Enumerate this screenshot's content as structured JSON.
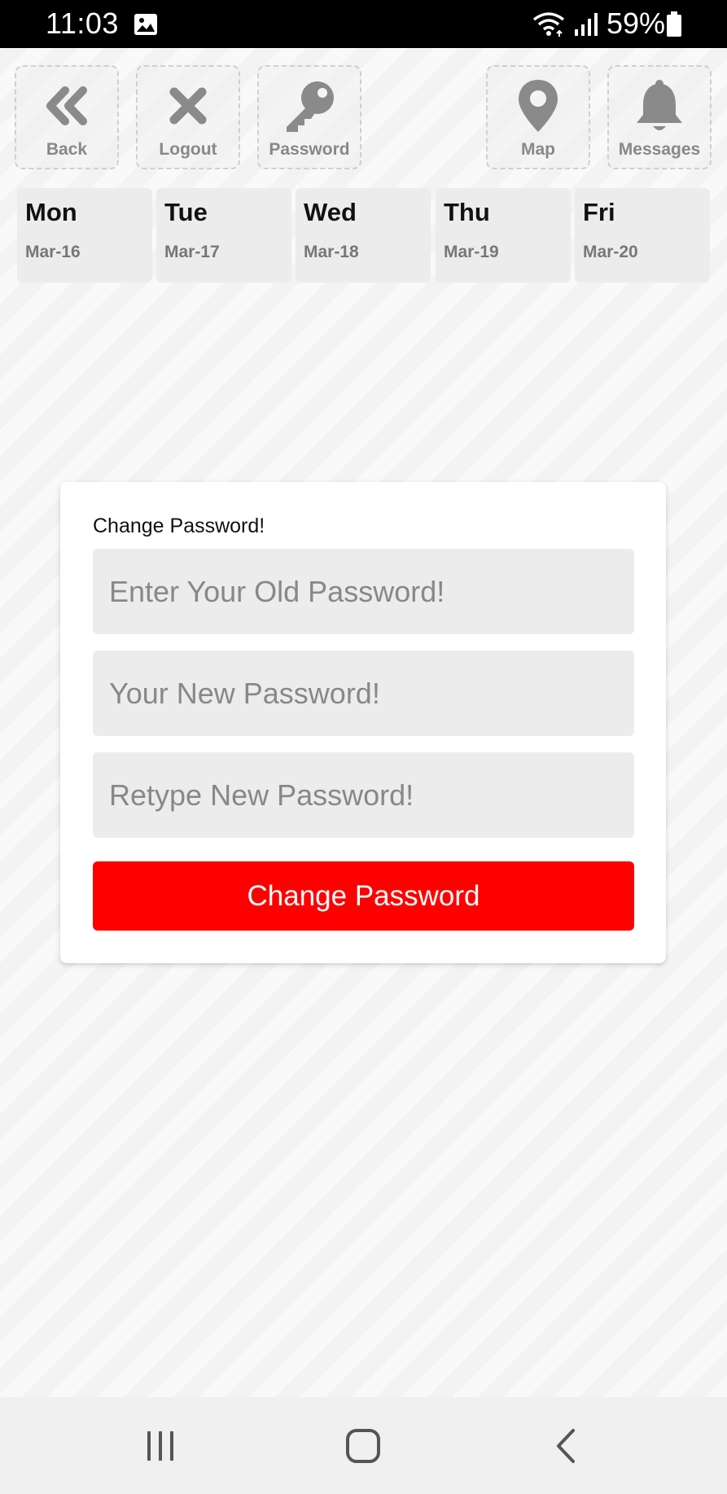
{
  "status_bar": {
    "time": "11:03",
    "battery": "59%",
    "icons": [
      "gallery-icon",
      "wifi-icon",
      "signal-icon",
      "battery-icon"
    ]
  },
  "toolbar": {
    "back_label": "Back",
    "logout_label": "Logout",
    "password_label": "Password",
    "map_label": "Map",
    "messages_label": "Messages"
  },
  "days": [
    {
      "name": "Mon",
      "date": "Mar-16"
    },
    {
      "name": "Tue",
      "date": "Mar-17"
    },
    {
      "name": "Wed",
      "date": "Mar-18"
    },
    {
      "name": "Thu",
      "date": "Mar-19"
    },
    {
      "name": "Fri",
      "date": "Mar-20"
    }
  ],
  "form": {
    "title": "Change Password!",
    "old_placeholder": "Enter Your Old Password!",
    "new_placeholder": "Your New Password!",
    "retype_placeholder": "Retype New Password!",
    "submit_label": "Change Password"
  },
  "colors": {
    "accent": "#ff0000",
    "icon_gray": "#8a8a8a"
  }
}
